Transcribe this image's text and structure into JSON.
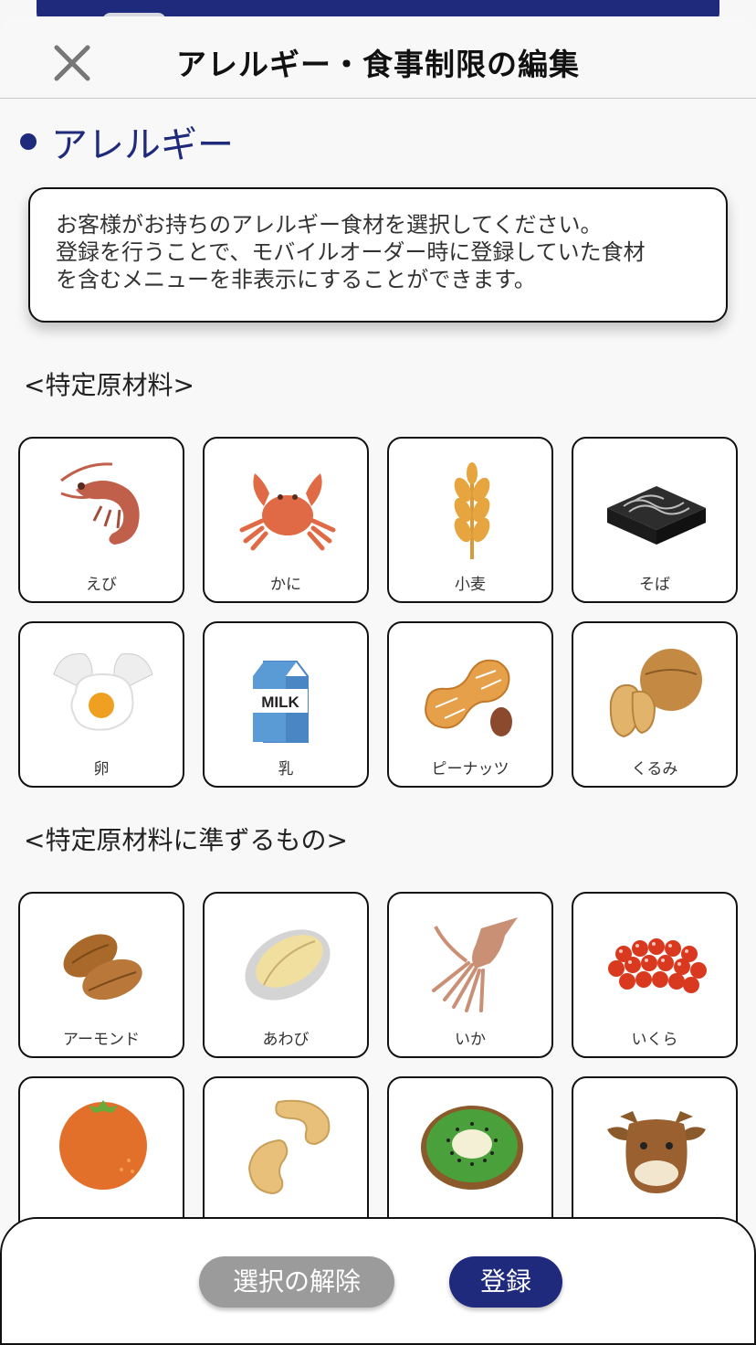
{
  "header": {
    "title": "アレルギー・食事制限の編集",
    "close_icon": "close-icon"
  },
  "section": {
    "title": "アレルギー"
  },
  "notice": {
    "lines": [
      "お客様がお持ちのアレルギー食材を選択してください。",
      "登録を行うことで、モバイルオーダー時に登録していた食材",
      "を含むメニューを非表示にすることができます。"
    ]
  },
  "groups": [
    {
      "label": "<特定原材料>",
      "items": [
        {
          "label": "えび",
          "icon": "shrimp-icon"
        },
        {
          "label": "かに",
          "icon": "crab-icon"
        },
        {
          "label": "小麦",
          "icon": "wheat-icon"
        },
        {
          "label": "そば",
          "icon": "soba-icon"
        },
        {
          "label": "卵",
          "icon": "egg-icon"
        },
        {
          "label": "乳",
          "icon": "milk-icon"
        },
        {
          "label": "ピーナッツ",
          "icon": "peanut-icon"
        },
        {
          "label": "くるみ",
          "icon": "walnut-icon"
        }
      ]
    },
    {
      "label": "<特定原材料に準ずるもの>",
      "items": [
        {
          "label": "アーモンド",
          "icon": "almond-icon"
        },
        {
          "label": "あわび",
          "icon": "abalone-icon"
        },
        {
          "label": "いか",
          "icon": "squid-icon"
        },
        {
          "label": "いくら",
          "icon": "salmon-roe-icon"
        },
        {
          "label": "",
          "icon": "orange-icon"
        },
        {
          "label": "",
          "icon": "cashew-icon"
        },
        {
          "label": "",
          "icon": "kiwi-icon"
        },
        {
          "label": "",
          "icon": "beef-icon"
        }
      ]
    }
  ],
  "footer": {
    "clear_label": "選択の解除",
    "register_label": "登録"
  },
  "colors": {
    "accent": "#1f2a7c",
    "clear_button": "#9b9b9b"
  }
}
